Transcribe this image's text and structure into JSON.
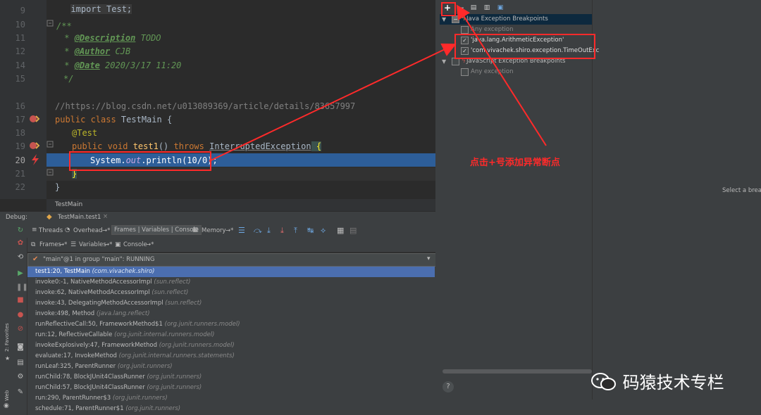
{
  "editor": {
    "lines": [
      {
        "num": "9",
        "text": "import Test;"
      },
      {
        "num": "10",
        "text": ""
      },
      {
        "num": "11",
        "text": "/**"
      },
      {
        "num": "12",
        "text": " * @Description TODO"
      },
      {
        "num": "13",
        "text": " * @Author CJB"
      },
      {
        "num": "14",
        "text": " * @Date 2020/3/17 11:20"
      },
      {
        "num": "15",
        "text": " */"
      },
      {
        "num": "16",
        "text": "//https://blog.csdn.net/u013089369/article/details/83657997"
      },
      {
        "num": "17",
        "text": "public class TestMain {"
      },
      {
        "num": "18",
        "text": "@Test"
      },
      {
        "num": "19",
        "text": "public void test1() throws InterruptedException {"
      },
      {
        "num": "20",
        "text": "System.out.println(10/0);"
      },
      {
        "num": "21",
        "text": "}"
      },
      {
        "num": "22",
        "text": "}"
      }
    ],
    "doc": {
      "open": "/**",
      "description_tag": "@Description",
      "description_val": " TODO",
      "author_tag": "@Author",
      "author_val": " CJB",
      "date_tag": "@Date",
      "date_val": " 2020/3/17 11:20",
      "close": "*/"
    },
    "url_comment": "//https://blog.csdn.net/u013089369/article/details/83657997",
    "class_line": {
      "kw": "public class ",
      "name": "TestMain {"
    },
    "annotation": "@Test",
    "method_line": {
      "kw1": "public void ",
      "name": "test1",
      "mid": "() ",
      "kw2": "throws ",
      "exc": "InterruptedException",
      "brace": " {"
    },
    "stmt": {
      "a": "System.",
      "field": "out",
      "b": ".println(",
      "num1": "10",
      "op": "/",
      "num2": "0",
      "c": ");"
    },
    "close_brace": "}",
    "breadcrumb": "TestMain"
  },
  "breakpoints": {
    "toolbar": {
      "add": "+",
      "remove": "−"
    },
    "groups": [
      {
        "label": "Java Exception Breakpoints",
        "checked": false,
        "expanded": true
      },
      {
        "label": "JavaScript Exception Breakpoints",
        "checked": false,
        "expanded": true
      }
    ],
    "java_items": [
      {
        "label": "Any exception",
        "checked": false
      },
      {
        "label": "'java.lang.ArithmeticException'",
        "checked": true
      },
      {
        "label": "'com.vivachek.shiro.exception.TimeOutExc",
        "checked": true
      }
    ],
    "js_items": [
      {
        "label": "Any exception",
        "checked": false
      }
    ],
    "detail_hint": "Select a brea",
    "help": "?"
  },
  "debug": {
    "title": "Debug:",
    "session_tab": "TestMain.test1",
    "close": "×",
    "toolbar": {
      "threads": "Threads",
      "overhead": "Overhead",
      "overhead_pin": "→*",
      "frames_vars_console": "Frames | Variables | Console",
      "memory": "Memory",
      "memory_pin": "→*"
    },
    "subtabs": {
      "frames": "Frames",
      "frames_pin": "→*",
      "variables": "Variables",
      "variables_pin": "→*",
      "console": "Console",
      "console_pin": "→*"
    },
    "thread": "\"main\"@1 in group \"main\": RUNNING",
    "frames": [
      {
        "method": "test1:20, TestMain",
        "pkg": "(com.vivachek.shiro)"
      },
      {
        "method": "invoke0:-1, NativeMethodAccessorImpl",
        "pkg": "(sun.reflect)"
      },
      {
        "method": "invoke:62, NativeMethodAccessorImpl",
        "pkg": "(sun.reflect)"
      },
      {
        "method": "invoke:43, DelegatingMethodAccessorImpl",
        "pkg": "(sun.reflect)"
      },
      {
        "method": "invoke:498, Method",
        "pkg": "(java.lang.reflect)"
      },
      {
        "method": "runReflectiveCall:50, FrameworkMethod$1",
        "pkg": "(org.junit.runners.model)"
      },
      {
        "method": "run:12, ReflectiveCallable",
        "pkg": "(org.junit.internal.runners.model)"
      },
      {
        "method": "invokeExplosively:47, FrameworkMethod",
        "pkg": "(org.junit.runners.model)"
      },
      {
        "method": "evaluate:17, InvokeMethod",
        "pkg": "(org.junit.internal.runners.statements)"
      },
      {
        "method": "runLeaf:325, ParentRunner",
        "pkg": "(org.junit.runners)"
      },
      {
        "method": "runChild:78, BlockJUnit4ClassRunner",
        "pkg": "(org.junit.runners)"
      },
      {
        "method": "runChild:57, BlockJUnit4ClassRunner",
        "pkg": "(org.junit.runners)"
      },
      {
        "method": "run:290, ParentRunner$3",
        "pkg": "(org.junit.runners)"
      },
      {
        "method": "schedule:71, ParentRunner$1",
        "pkg": "(org.junit.runners)"
      }
    ],
    "side": {
      "favorites": "2: Favorites",
      "web": "Web"
    }
  },
  "annotation": {
    "text": "点击+号添加异常断点",
    "color": "#ff2a2a"
  },
  "watermark": "码猿技术专栏"
}
